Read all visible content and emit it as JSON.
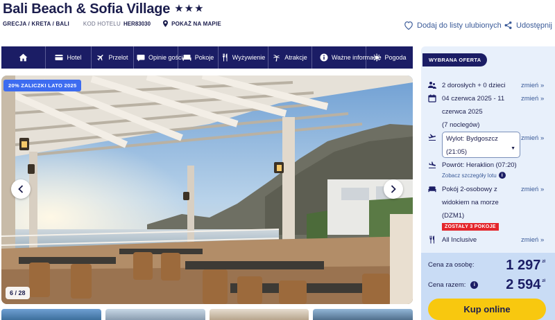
{
  "hotel": {
    "name": "Bali Beach & Sofia Village",
    "stars": "★★★",
    "breadcrumb": "GRECJA / KRETA / BALI",
    "code_label": "KOD HOTELU",
    "code_value": "HER83030",
    "map_link": "POKAŻ NA MAPIE"
  },
  "actions": {
    "favorite": "Dodaj do listy ulubionych",
    "share": "Udostępnij"
  },
  "nav": {
    "home_icon": "home-icon",
    "items": [
      {
        "label": "Hotel",
        "icon": "hotel-card-icon"
      },
      {
        "label": "Przelot",
        "icon": "plane-icon"
      },
      {
        "label": "Opinie gości",
        "icon": "chat-bubble-icon"
      },
      {
        "label": "Pokoje",
        "icon": "bed-icon"
      },
      {
        "label": "Wyżywienie",
        "icon": "cutlery-icon"
      },
      {
        "label": "Atrakcje",
        "icon": "palm-icon"
      },
      {
        "label": "Ważne informacje",
        "icon": "info-icon"
      },
      {
        "label": "Pogoda",
        "icon": "sun-icon"
      }
    ]
  },
  "gallery": {
    "promo_badge": "20% ZALICZKI LATO 2025",
    "counter": "6 / 28",
    "current": 6,
    "total": 28
  },
  "offer": {
    "tag": "WYBRANA OFERTA",
    "change_label": "zmień »",
    "guests": "2 dorosłych + 0 dzieci",
    "dates": "04 czerwca 2025 - 11 czerwca 2025",
    "nights": "(7 noclegów)",
    "departure": "Wylot: Bydgoszcz (21:05)",
    "return": "Powrót: Heraklion (07:20)",
    "flight_details": "Zobacz szczegóły lotu",
    "room": "Pokój 2-osobowy z widokiem na morze (DZM1)",
    "rooms_left": "ZOSTAŁY 3 POKOJE",
    "board": "All Inclusive"
  },
  "price": {
    "per_person_label": "Cena za osobę:",
    "per_person_value": "1 297",
    "total_label": "Cena razem:",
    "total_value": "2 594",
    "currency": "zł",
    "book_button": "Kup online"
  },
  "colors": {
    "navy": "#1b1d65",
    "accent_blue": "#3d6cf0",
    "link": "#3a5a98",
    "panel_bg": "#e8f0fb",
    "price_bg": "#c9dcf5",
    "cta_yellow": "#f8c80f",
    "alert_red": "#e4262c"
  }
}
